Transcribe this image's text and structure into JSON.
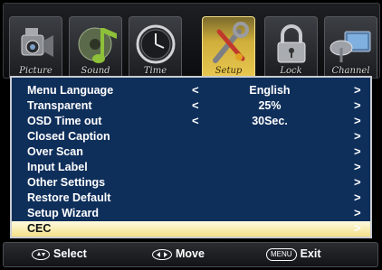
{
  "tabs": [
    {
      "label": "Picture",
      "icon": "camcorder-icon",
      "active": false
    },
    {
      "label": "Sound",
      "icon": "music-note-icon",
      "active": false
    },
    {
      "label": "Time",
      "icon": "clock-icon",
      "active": false
    },
    {
      "label": "Setup",
      "icon": "wrench-icon",
      "active": true
    },
    {
      "label": "Lock",
      "icon": "padlock-icon",
      "active": false
    },
    {
      "label": "Channel",
      "icon": "satellite-dish-icon",
      "active": false
    }
  ],
  "menu": [
    {
      "label": "Menu Language",
      "value": "English",
      "left_arrow": "<"
    },
    {
      "label": "Transparent",
      "value": "25%",
      "left_arrow": "<"
    },
    {
      "label": "OSD Time out",
      "value": "30Sec.",
      "left_arrow": "<"
    },
    {
      "label": "Closed Caption",
      "value": "",
      "left_arrow": ""
    },
    {
      "label": "Over Scan",
      "value": "",
      "left_arrow": ""
    },
    {
      "label": "Input Label",
      "value": "",
      "left_arrow": ""
    },
    {
      "label": "Other Settings",
      "value": "",
      "left_arrow": ""
    },
    {
      "label": "Restore Default",
      "value": "",
      "left_arrow": ""
    },
    {
      "label": "Setup Wizard",
      "value": "",
      "left_arrow": ""
    },
    {
      "label": "CEC",
      "value": "",
      "left_arrow": ""
    }
  ],
  "selected_index": 9,
  "right_arrow": ">",
  "hints": {
    "select_label": "Select",
    "move_label": "Move",
    "menu_key": "MENU",
    "exit_label": "Exit"
  },
  "colors": {
    "panel_bg": "#0f2f5b",
    "selected_bg": "#f4e089",
    "active_tab": "#e9c850"
  }
}
